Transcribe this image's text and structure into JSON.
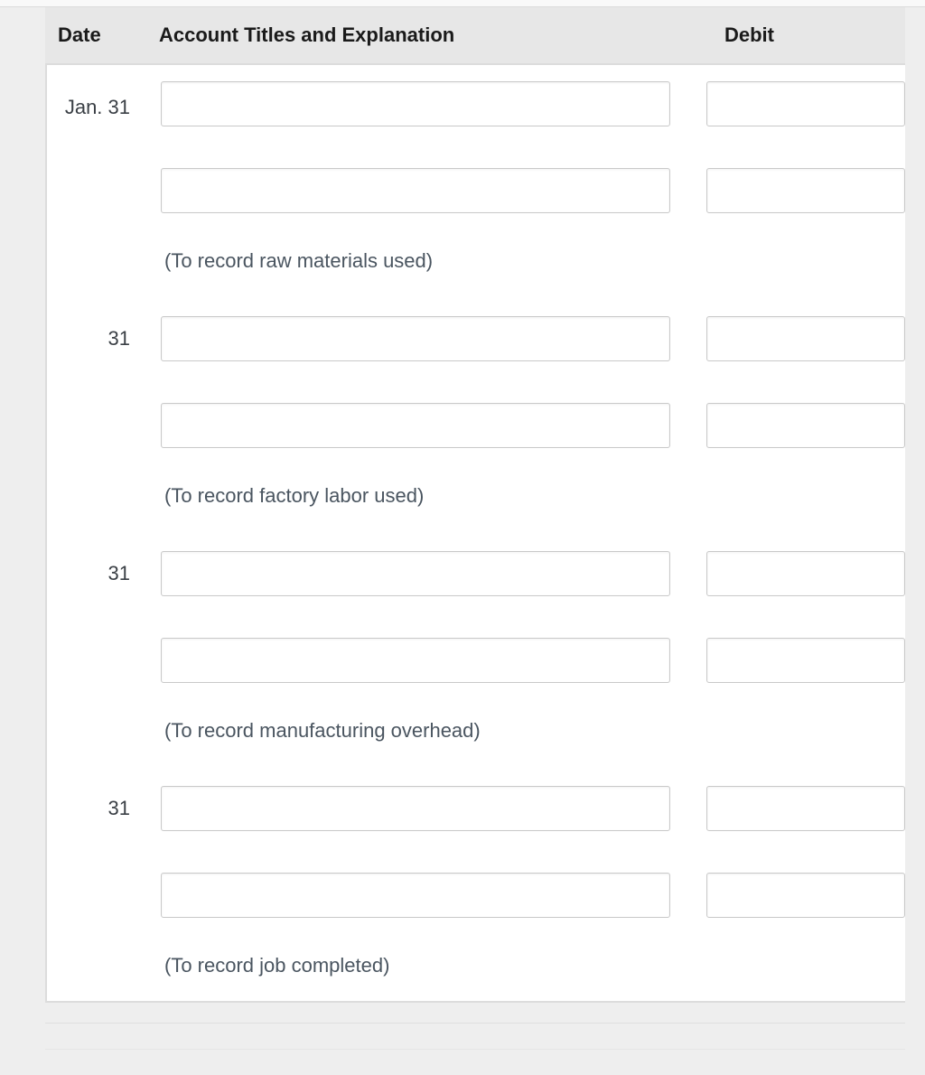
{
  "headers": {
    "date": "Date",
    "account": "Account Titles and Explanation",
    "debit": "Debit"
  },
  "entries": [
    {
      "date": "Jan. 31",
      "account1": "",
      "debit1": "",
      "account2": "",
      "debit2": "",
      "explain": "(To record raw materials used)"
    },
    {
      "date": "31",
      "account1": "",
      "debit1": "",
      "account2": "",
      "debit2": "",
      "explain": "(To record factory labor used)"
    },
    {
      "date": "31",
      "account1": "",
      "debit1": "",
      "account2": "",
      "debit2": "",
      "explain": "(To record manufacturing overhead)"
    },
    {
      "date": "31",
      "account1": "",
      "debit1": "",
      "account2": "",
      "debit2": "",
      "explain": "(To record job completed)"
    }
  ]
}
